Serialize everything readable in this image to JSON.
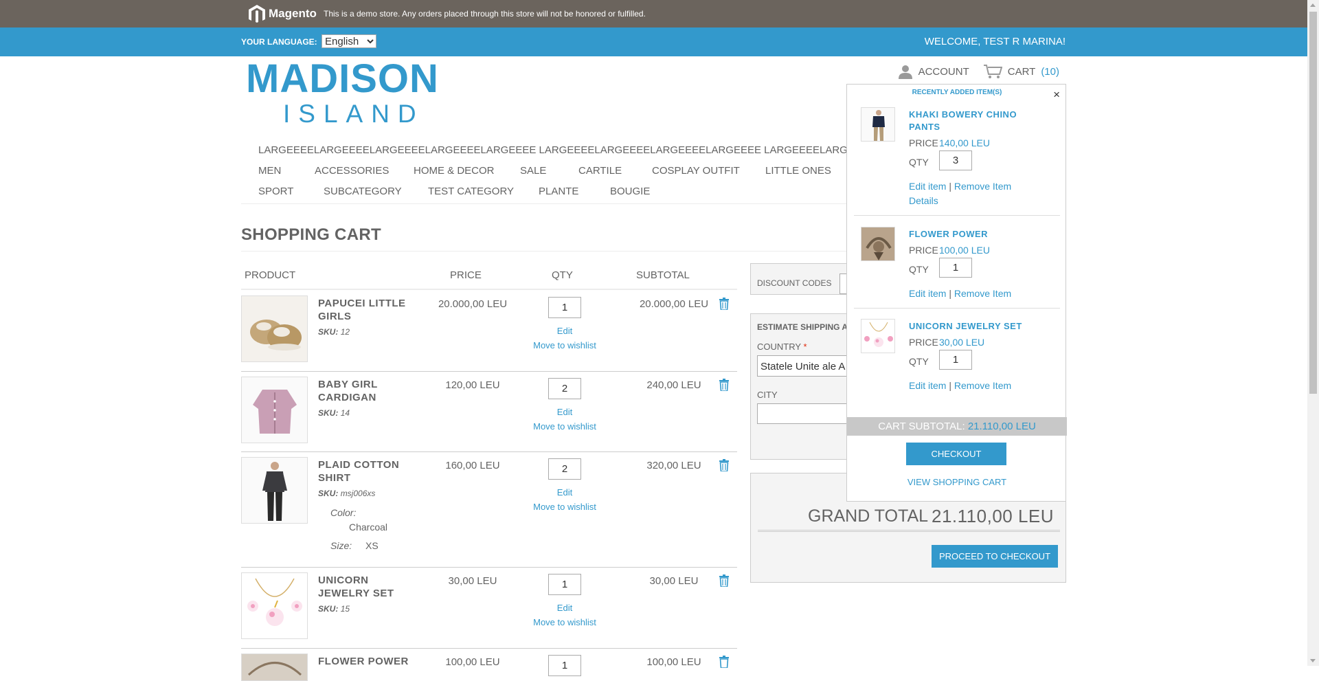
{
  "demo_bar": {
    "brand": "Magento",
    "notice": "This is a demo store. Any orders placed through this store will not be honored or fulfilled."
  },
  "lang_bar": {
    "label": "YOUR LANGUAGE:",
    "language": "English",
    "welcome": "WELCOME, TEST R MARINA!"
  },
  "brand": {
    "line1": "MADISON",
    "line2": "ISLAND"
  },
  "account": {
    "account_label": "ACCOUNT",
    "cart_label": "CART",
    "cart_count": "(10)"
  },
  "nav": {
    "long_item": "LARGEEEELARGEEEELARGEEEELARGEEEELARGEEEE LARGEEEELARGEEEELARGEEEELARGEEEE LARGEEEELARGEEEELARGEEEE",
    "row1": [
      "MEN",
      "ACCESSORIES",
      "HOME & DECOR",
      "SALE",
      "CARTILE",
      "COSPLAY OUTFIT",
      "LITTLE ONES"
    ],
    "row2": [
      "SPORT",
      "SUBCATEGORY",
      "TEST CATEGORY",
      "PLANTE",
      "BOUGIE"
    ]
  },
  "page_title": "SHOPPING CART",
  "table": {
    "headers": {
      "product": "PRODUCT",
      "price": "PRICE",
      "qty": "QTY",
      "subtotal": "SUBTOTAL"
    },
    "edit_label": "Edit",
    "wishlist_label": "Move to wishlist",
    "sku_label": "SKU:",
    "rows": [
      {
        "name": "PAPUCEI LITTLE GIRLS",
        "sku": "12",
        "price": "20.000,00 LEU",
        "qty": "1",
        "subtotal": "20.000,00 LEU"
      },
      {
        "name": "BABY GIRL CARDIGAN",
        "sku": "14",
        "price": "120,00 LEU",
        "qty": "2",
        "subtotal": "240,00 LEU"
      },
      {
        "name": "PLAID COTTON SHIRT",
        "sku": "msj006xs",
        "price": "160,00 LEU",
        "qty": "2",
        "subtotal": "320,00 LEU",
        "options": {
          "color_label": "Color:",
          "color_value": "Charcoal",
          "size_label": "Size:",
          "size_value": "XS"
        }
      },
      {
        "name": "UNICORN JEWELRY SET",
        "sku": "15",
        "price": "30,00 LEU",
        "qty": "1",
        "subtotal": "30,00 LEU"
      },
      {
        "name": "FLOWER POWER",
        "price": "100,00 LEU",
        "qty": "1",
        "subtotal": "100,00 LEU"
      }
    ]
  },
  "sidebar": {
    "discount_label": "DISCOUNT CODES",
    "estimate_label": "ESTIMATE SHIPPING AI",
    "country_label": "COUNTRY",
    "required_mark": "*",
    "country_value": "Statele Unite ale A",
    "city_label": "CITY",
    "city_value": "",
    "grand_total_label": "GRAND TOTAL",
    "grand_total_value": "21.110,00 LEU",
    "proceed_label": "PROCEED TO CHECKOUT"
  },
  "minicart": {
    "heading": "RECENTLY ADDED ITEM(S)",
    "close": "×",
    "price_label": "PRICE",
    "qty_label": "QTY",
    "edit_label": "Edit item",
    "remove_label": "Remove Item",
    "separator": "|",
    "details_label": "Details",
    "items": [
      {
        "name": "KHAKI BOWERY CHINO PANTS",
        "price": "140,00 LEU",
        "qty": "3"
      },
      {
        "name": "FLOWER POWER",
        "price": "100,00 LEU",
        "qty": "1"
      },
      {
        "name": "UNICORN JEWELRY SET",
        "price": "30,00 LEU",
        "qty": "1"
      }
    ],
    "subtotal_label": "CART SUBTOTAL:",
    "subtotal_value": "21.110,00 LEU",
    "checkout_label": "CHECKOUT",
    "view_cart_label": "VIEW SHOPPING CART"
  },
  "colors": {
    "accent": "#3399cc",
    "demo_bar": "#6b645d",
    "text": "#636363"
  }
}
